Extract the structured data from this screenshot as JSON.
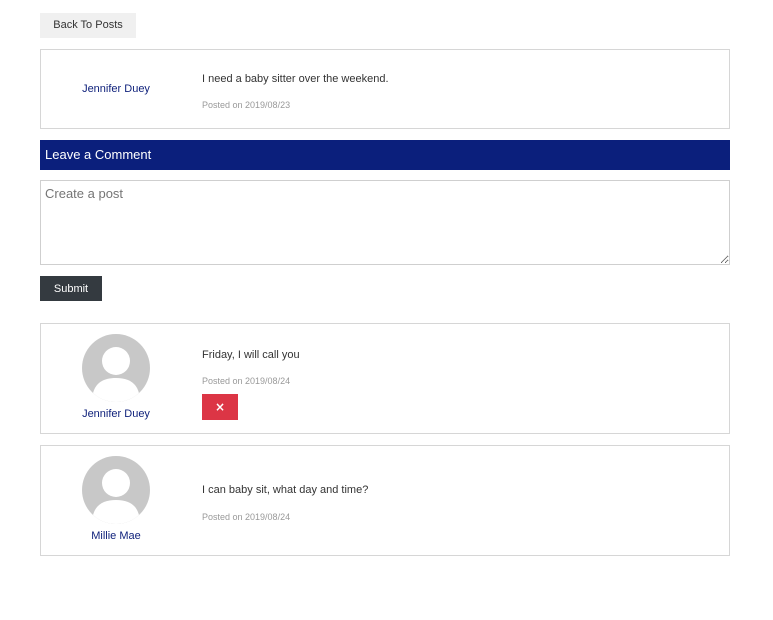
{
  "nav": {
    "back_label": "Back To Posts"
  },
  "post": {
    "author": "Jennifer Duey",
    "text": "I need a baby sitter over the weekend.",
    "date": "Posted on 2019/08/23"
  },
  "comment_form": {
    "header": "Leave a Comment",
    "placeholder": "Create a post",
    "submit_label": "Submit"
  },
  "comments": [
    {
      "author": "Jennifer Duey",
      "text": "Friday, I will call you",
      "date": "Posted on 2019/08/24",
      "delete_label": "×",
      "avatar_icon": "default-user-avatar"
    },
    {
      "author": "Millie Mae",
      "text": "I can baby sit, what day and time?",
      "date": "Posted on 2019/08/24",
      "avatar_icon": "default-user-avatar"
    }
  ],
  "colors": {
    "accent": "#0b1f7c",
    "author_link": "#0d1f7a",
    "delete": "#dc3545",
    "submit": "#343a40"
  }
}
